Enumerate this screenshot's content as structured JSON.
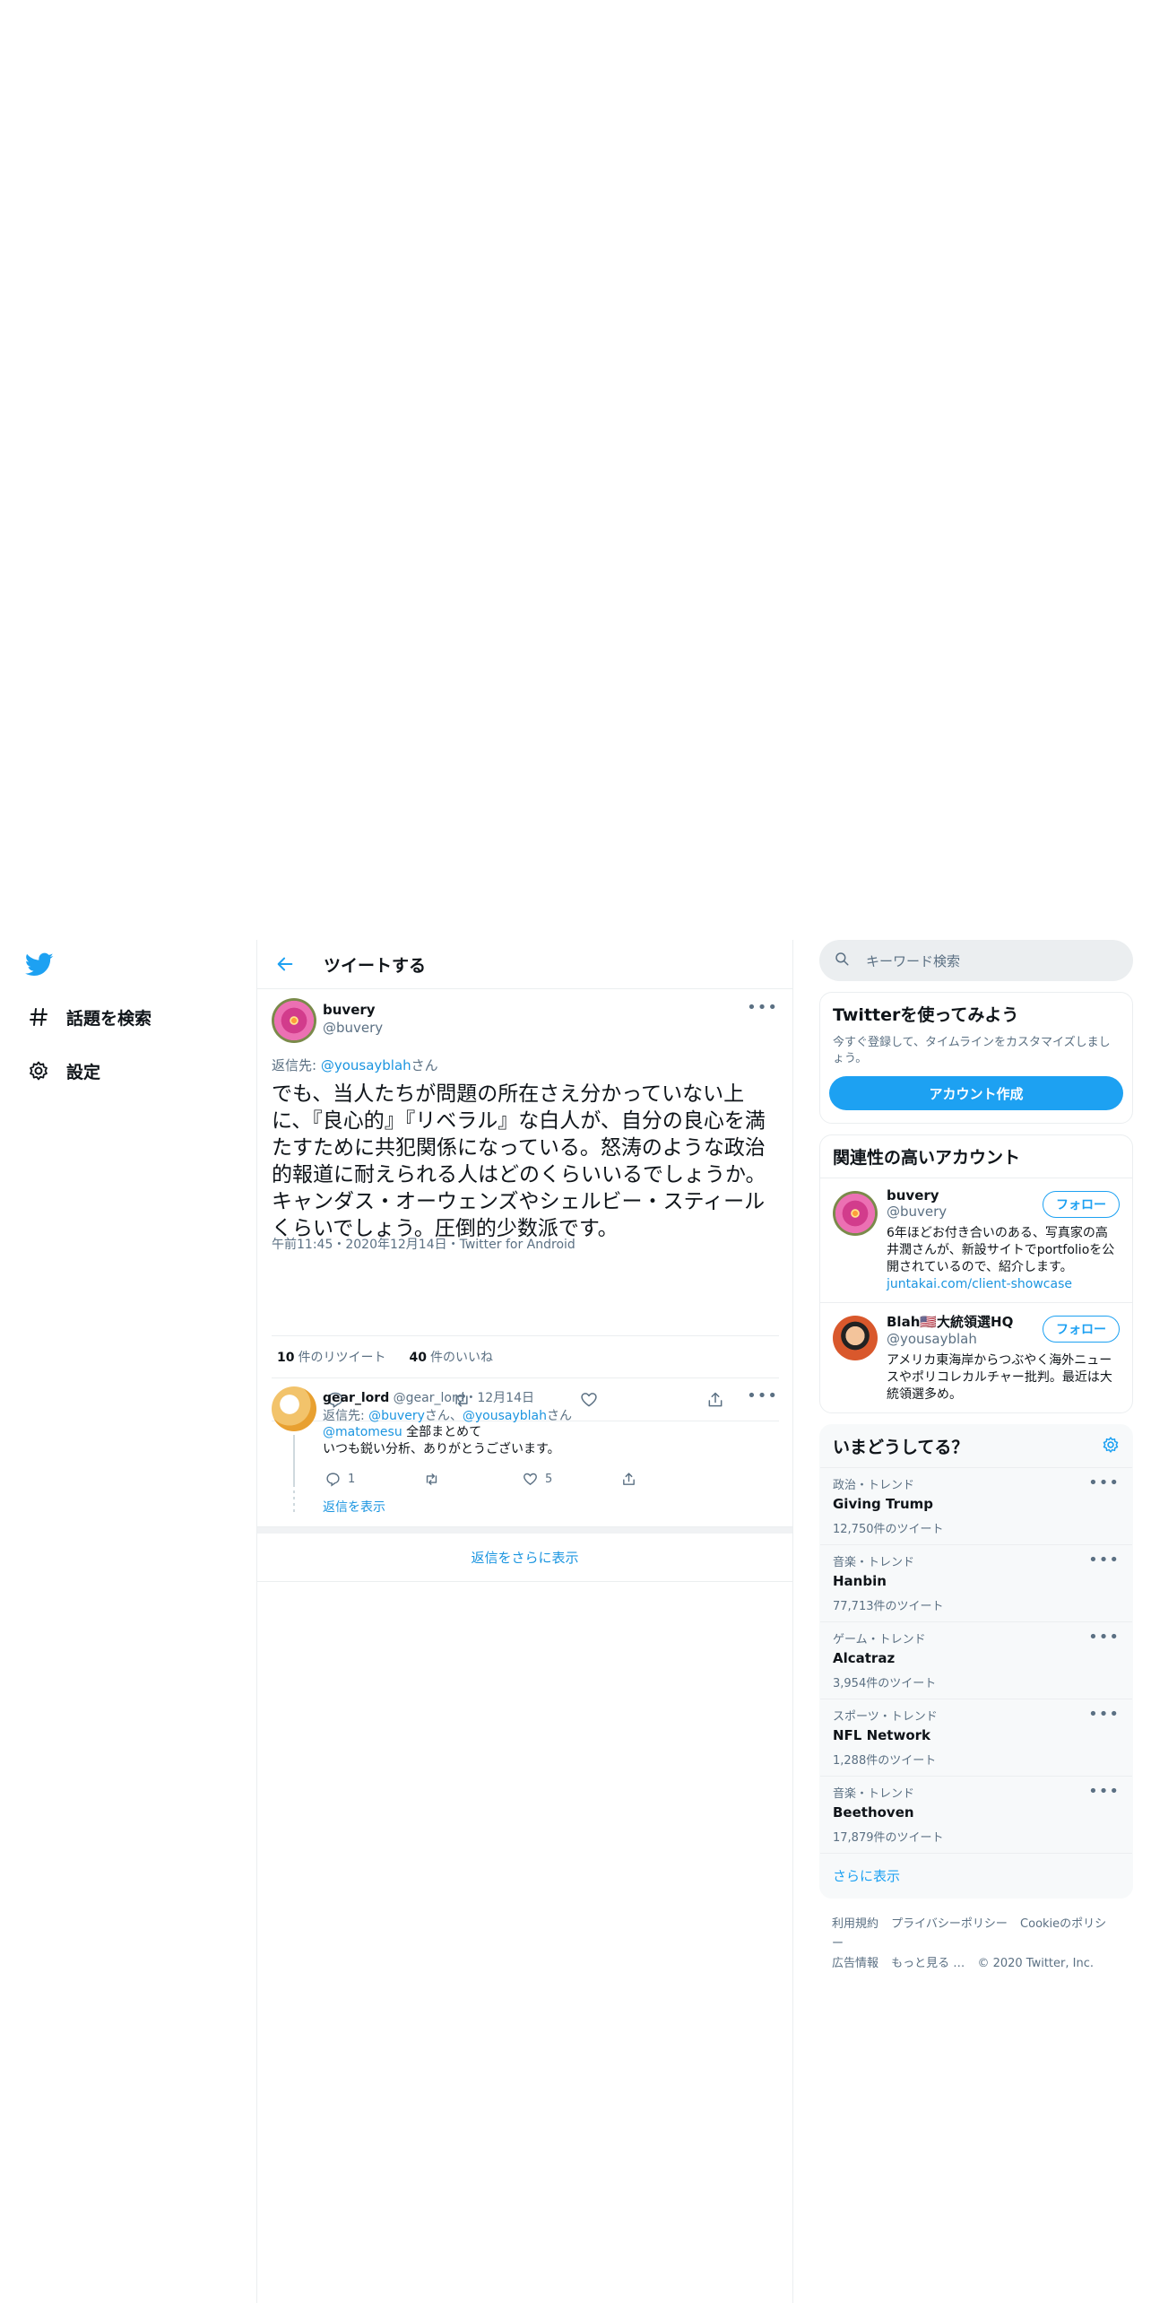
{
  "nav": {
    "items": [
      {
        "label": "話題を検索",
        "icon": "hashtag-icon"
      },
      {
        "label": "設定",
        "icon": "gear-icon"
      }
    ]
  },
  "header": {
    "title": "ツイートする"
  },
  "tweet": {
    "name": "buvery",
    "handle": "@buvery",
    "reply_prefix": "返信先: ",
    "reply_to": "@yousayblah",
    "reply_suffix": "さん",
    "text": "でも、当人たちが問題の所在さえ分かっていない上に、『良心的』『リベラル』な白人が、自分の良心を満たすために共犯関係になっている。怒涛のような政治的報道に耐えられる人はどのくらいいるでしょうか。キャンダス・オーウェンズやシェルビー・スティールくらいでしょう。圧倒的少数派です。",
    "meta": "午前11:45・2020年12月14日・Twitter for Android",
    "retweets": "10",
    "retweets_label": "件のリツイート",
    "likes": "40",
    "likes_label": "件のいいね"
  },
  "reply": {
    "name": "gear_lord",
    "handle": "@gear_lord",
    "date": "・12月14日",
    "reply_prefix": "返信先: ",
    "reply_to_1": "@buvery",
    "reply_mid": "さん、",
    "reply_to_2": "@yousayblah",
    "reply_suffix": "さん",
    "mention": "@matomesu",
    "text_1": " 全部まとめて",
    "text_2": "いつも鋭い分析、ありがとうございます。",
    "reply_count": "1",
    "like_count": "5",
    "show_replies": "返信を表示"
  },
  "show_more_replies": "返信をさらに表示",
  "search": {
    "placeholder": "キーワード検索"
  },
  "signup": {
    "title": "Twitterを使ってみよう",
    "desc": "今すぐ登録して、タイムラインをカスタマイズしましょう。",
    "button": "アカウント作成"
  },
  "related": {
    "title": "関連性の高いアカウント",
    "follow_label": "フォロー",
    "accounts": [
      {
        "name": "buvery",
        "handle": "@buvery",
        "bio": "6年ほどお付き合いのある、写真家の高井潤さんが、新設サイトでportfolioを公開されているので、紹介します。",
        "link": "juntakai.com/client-showcase"
      },
      {
        "name": "Blah🇺🇸大統領選HQ",
        "handle": "@yousayblah",
        "bio": "アメリカ東海岸からつぶやく海外ニュースやポリコレカルチャー批判。最近は大統領選多め。",
        "link": ""
      }
    ]
  },
  "trends": {
    "title": "いまどうしてる？",
    "items": [
      {
        "category": "政治・トレンド",
        "name": "Giving Trump",
        "count": "12,750件のツイート"
      },
      {
        "category": "音楽・トレンド",
        "name": "Hanbin",
        "count": "77,713件のツイート"
      },
      {
        "category": "ゲーム・トレンド",
        "name": "Alcatraz",
        "count": "3,954件のツイート"
      },
      {
        "category": "スポーツ・トレンド",
        "name": "NFL Network",
        "count": "1,288件のツイート"
      },
      {
        "category": "音楽・トレンド",
        "name": "Beethoven",
        "count": "17,879件のツイート"
      }
    ],
    "show_more": "さらに表示"
  },
  "footer": {
    "links": [
      "利用規約",
      "プライバシーポリシー",
      "Cookieのポリシー",
      "広告情報",
      "もっと見る …"
    ],
    "copyright": "© 2020 Twitter, Inc."
  },
  "colors": {
    "accent": "#1da1f2",
    "link": "#1b95e0",
    "muted": "#5b7083"
  }
}
